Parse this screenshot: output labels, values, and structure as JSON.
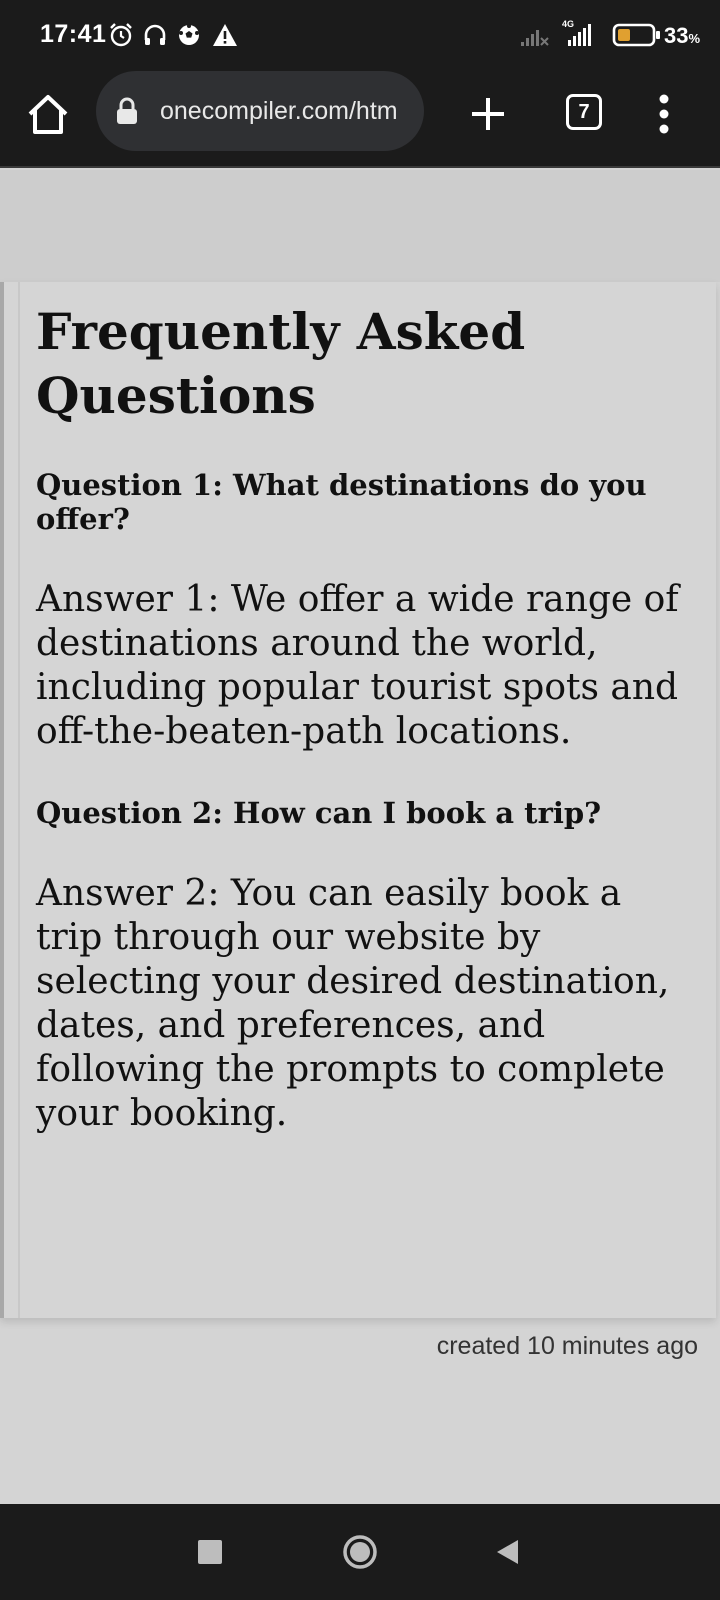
{
  "status_bar": {
    "time": "17:41",
    "network": "4G",
    "battery_percent": "33",
    "battery_unit": "%",
    "icons": [
      "alarm-icon",
      "headset-icon",
      "football-icon",
      "warning-icon",
      "signal-off-icon",
      "signal-4g-icon",
      "battery-icon"
    ]
  },
  "browser": {
    "url": "onecompiler.com/htm",
    "tab_count": "7",
    "icons": [
      "home-icon",
      "lock-icon",
      "plus-icon",
      "tabs-icon",
      "more-vert-icon"
    ]
  },
  "page": {
    "heading": "Frequently Asked Questions",
    "faqs": [
      {
        "question": "Question 1: What destinations do you offer?",
        "answer": "Answer 1: We offer a wide range of destinations around the world, including popular tourist spots and off-the-beaten-path locations."
      },
      {
        "question": "Question 2: How can I book a trip?",
        "answer": "Answer 2: You can easily book a trip through our website by selecting your desired destination, dates, and preferences, and following the prompts to complete your booking."
      }
    ],
    "footer": "created 10 minutes ago"
  },
  "nav_bar": {
    "icons": [
      "recents-icon",
      "home-circle-icon",
      "back-icon"
    ]
  },
  "colors": {
    "system_bar": "#1b1b1b",
    "url_bar": "#2f3033",
    "page_bg": "#d4d4d4",
    "text": "#111111",
    "battery_fill": "#e0a030"
  }
}
